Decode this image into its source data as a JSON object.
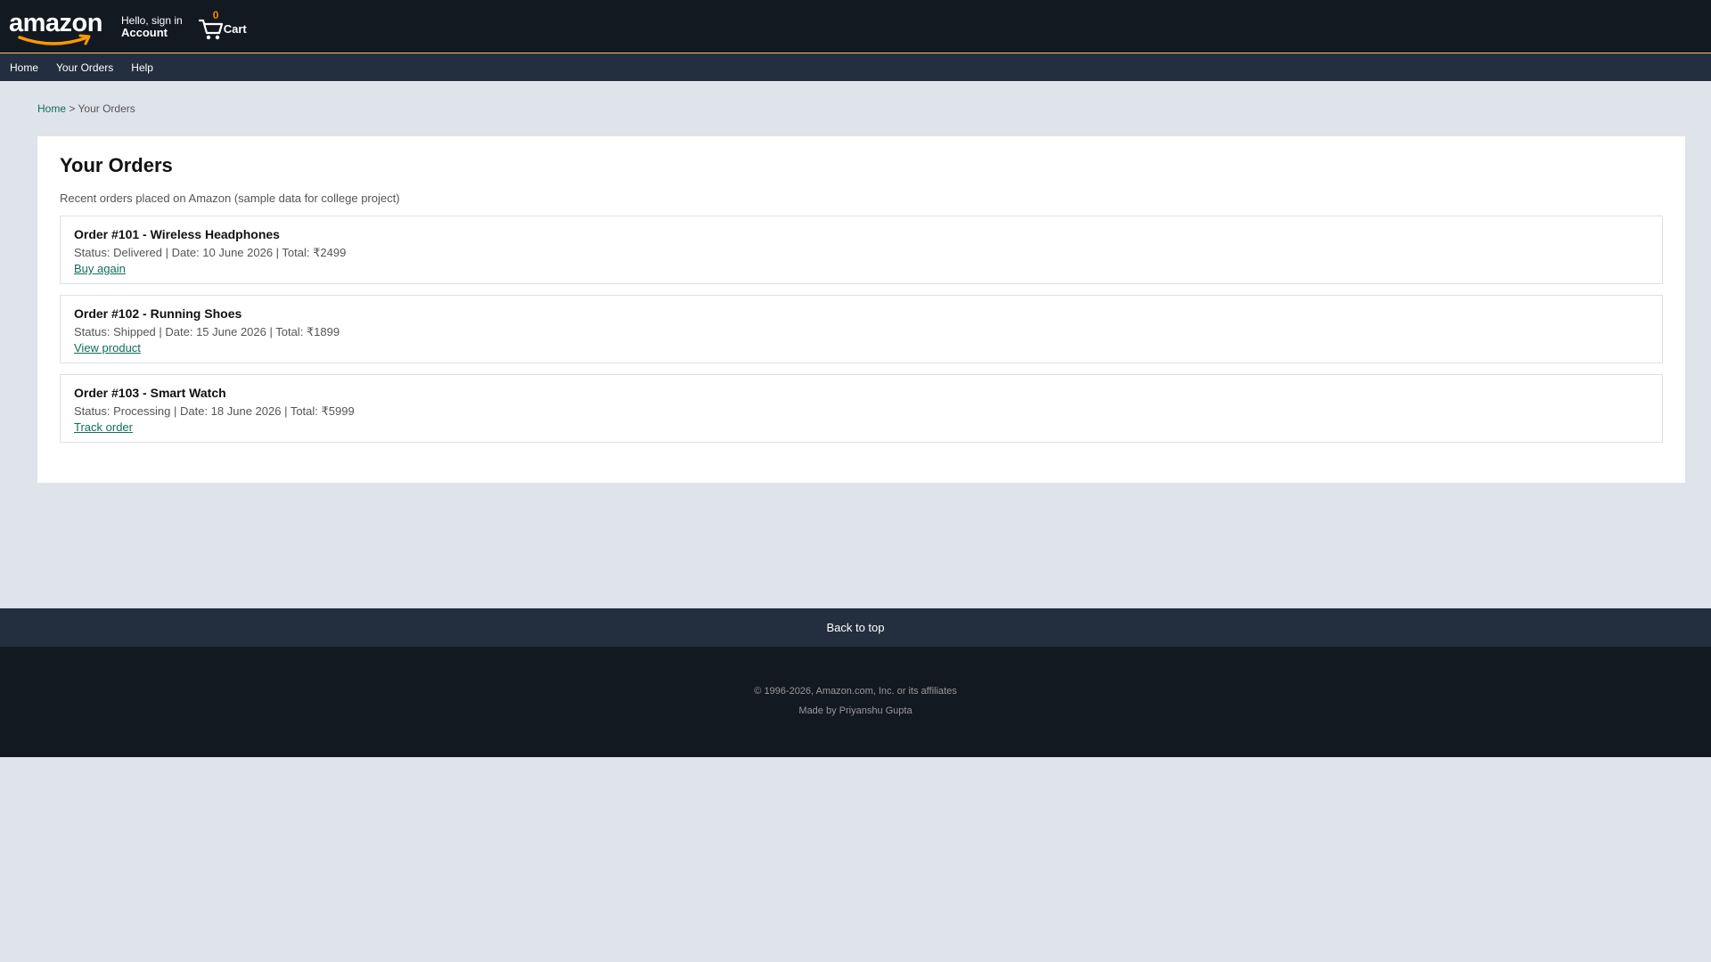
{
  "header": {
    "logo_text": "amazon",
    "hello": "Hello, sign in",
    "account": "Account",
    "cart_count": "0",
    "cart_label": "Cart"
  },
  "nav": {
    "items": [
      "Home",
      "Your Orders",
      "Help"
    ]
  },
  "breadcrumb": {
    "home": "Home",
    "separator": ">",
    "current": "Your Orders"
  },
  "main": {
    "title": "Your Orders",
    "subtitle": "Recent orders placed on Amazon (sample data for college project)",
    "orders": [
      {
        "title": "Order #101 - Wireless Headphones",
        "meta": "Status: Delivered | Date: 10 June 2026 | Total: ₹2499",
        "action": "Buy again"
      },
      {
        "title": "Order #102 - Running Shoes",
        "meta": "Status: Shipped | Date: 15 June 2026 | Total: ₹1899",
        "action": "View product"
      },
      {
        "title": "Order #103 - Smart Watch",
        "meta": "Status: Processing | Date: 18 June 2026 | Total: ₹5999",
        "action": "Track order"
      }
    ]
  },
  "footer": {
    "back_to_top": "Back to top",
    "copyright": "© 1996-2026, Amazon.com, Inc. or its affiliates",
    "made_by": "Made by Priyanshu Gupta"
  },
  "colors": {
    "topbar": "#131921",
    "navbar": "#232f3e",
    "accent": "#febd69",
    "link": "#0f6e5c",
    "background": "#dfe3ea"
  }
}
